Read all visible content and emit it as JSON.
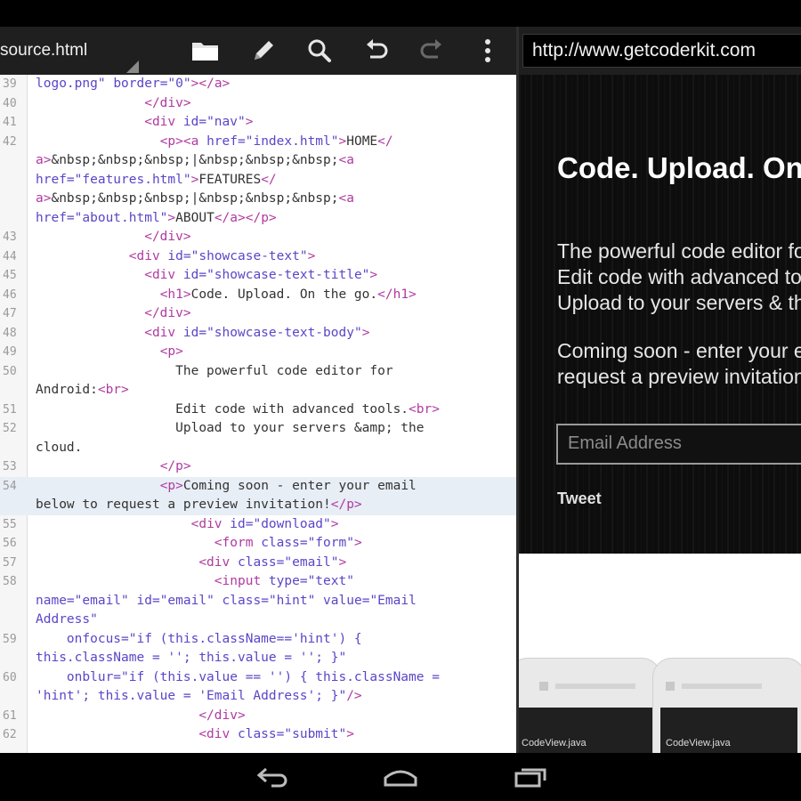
{
  "editor": {
    "file_tab": "source.html",
    "toolbar_icons": [
      "folder-icon",
      "pencil-icon",
      "search-icon",
      "undo-icon",
      "redo-icon",
      "overflow-menu-icon"
    ]
  },
  "code_lines": [
    {
      "ln": "39",
      "tokens": [
        {
          "c": "t-str",
          "t": "logo.png\" "
        },
        {
          "c": "t-attr",
          "t": "border="
        },
        {
          "c": "t-str",
          "t": "\"0\""
        },
        {
          "c": "t-tag",
          "t": "></a>"
        }
      ]
    },
    {
      "ln": "40",
      "tokens": [
        {
          "c": "t-txt",
          "t": "              "
        },
        {
          "c": "t-tag",
          "t": "</div>"
        }
      ]
    },
    {
      "ln": "41",
      "tokens": [
        {
          "c": "t-txt",
          "t": "              "
        },
        {
          "c": "t-tag",
          "t": "<div "
        },
        {
          "c": "t-attr",
          "t": "id="
        },
        {
          "c": "t-str",
          "t": "\"nav\""
        },
        {
          "c": "t-tag",
          "t": ">"
        }
      ]
    },
    {
      "ln": "42",
      "tokens": [
        {
          "c": "t-txt",
          "t": "                "
        },
        {
          "c": "t-tag",
          "t": "<p><a "
        },
        {
          "c": "t-attr",
          "t": "href="
        },
        {
          "c": "t-str",
          "t": "\"index.html\""
        },
        {
          "c": "t-tag",
          "t": ">"
        },
        {
          "c": "t-txt",
          "t": "HOME"
        },
        {
          "c": "t-tag",
          "t": "</"
        }
      ]
    },
    {
      "ln": "",
      "tokens": [
        {
          "c": "t-tag",
          "t": "a>"
        },
        {
          "c": "t-txt",
          "t": "&nbsp;&nbsp;&nbsp;|&nbsp;&nbsp;&nbsp;"
        },
        {
          "c": "t-tag",
          "t": "<a"
        }
      ]
    },
    {
      "ln": "",
      "tokens": [
        {
          "c": "t-attr",
          "t": "href="
        },
        {
          "c": "t-str",
          "t": "\"features.html\""
        },
        {
          "c": "t-tag",
          "t": ">"
        },
        {
          "c": "t-txt",
          "t": "FEATURES"
        },
        {
          "c": "t-tag",
          "t": "</"
        }
      ]
    },
    {
      "ln": "",
      "tokens": [
        {
          "c": "t-tag",
          "t": "a>"
        },
        {
          "c": "t-txt",
          "t": "&nbsp;&nbsp;&nbsp;|&nbsp;&nbsp;&nbsp;"
        },
        {
          "c": "t-tag",
          "t": "<a"
        }
      ]
    },
    {
      "ln": "",
      "tokens": [
        {
          "c": "t-attr",
          "t": "href="
        },
        {
          "c": "t-str",
          "t": "\"about.html\""
        },
        {
          "c": "t-tag",
          "t": ">"
        },
        {
          "c": "t-txt",
          "t": "ABOUT"
        },
        {
          "c": "t-tag",
          "t": "</a></p>"
        }
      ]
    },
    {
      "ln": "43",
      "tokens": [
        {
          "c": "t-txt",
          "t": "              "
        },
        {
          "c": "t-tag",
          "t": "</div>"
        }
      ]
    },
    {
      "ln": "44",
      "tokens": [
        {
          "c": "t-txt",
          "t": "            "
        },
        {
          "c": "t-tag",
          "t": "<div "
        },
        {
          "c": "t-attr",
          "t": "id="
        },
        {
          "c": "t-str",
          "t": "\"showcase-text\""
        },
        {
          "c": "t-tag",
          "t": ">"
        }
      ]
    },
    {
      "ln": "45",
      "tokens": [
        {
          "c": "t-txt",
          "t": "              "
        },
        {
          "c": "t-tag",
          "t": "<div "
        },
        {
          "c": "t-attr",
          "t": "id="
        },
        {
          "c": "t-str",
          "t": "\"showcase-text-title\""
        },
        {
          "c": "t-tag",
          "t": ">"
        }
      ]
    },
    {
      "ln": "46",
      "tokens": [
        {
          "c": "t-txt",
          "t": "                "
        },
        {
          "c": "t-tag",
          "t": "<h1>"
        },
        {
          "c": "t-txt",
          "t": "Code. Upload. On the go."
        },
        {
          "c": "t-tag",
          "t": "</h1>"
        }
      ]
    },
    {
      "ln": "47",
      "tokens": [
        {
          "c": "t-txt",
          "t": "              "
        },
        {
          "c": "t-tag",
          "t": "</div>"
        }
      ]
    },
    {
      "ln": "48",
      "tokens": [
        {
          "c": "t-txt",
          "t": "              "
        },
        {
          "c": "t-tag",
          "t": "<div "
        },
        {
          "c": "t-attr",
          "t": "id="
        },
        {
          "c": "t-str",
          "t": "\"showcase-text-body\""
        },
        {
          "c": "t-tag",
          "t": ">"
        }
      ]
    },
    {
      "ln": "49",
      "tokens": [
        {
          "c": "t-txt",
          "t": "                "
        },
        {
          "c": "t-tag",
          "t": "<p>"
        }
      ]
    },
    {
      "ln": "50",
      "tokens": [
        {
          "c": "t-txt",
          "t": "                  The powerful code editor for"
        }
      ]
    },
    {
      "ln": "",
      "tokens": [
        {
          "c": "t-txt",
          "t": "Android:"
        },
        {
          "c": "t-tag",
          "t": "<br>"
        }
      ]
    },
    {
      "ln": "51",
      "tokens": [
        {
          "c": "t-txt",
          "t": "                  Edit code with advanced tools."
        },
        {
          "c": "t-tag",
          "t": "<br>"
        }
      ]
    },
    {
      "ln": "52",
      "tokens": [
        {
          "c": "t-txt",
          "t": "                  Upload to your servers &amp; the"
        }
      ]
    },
    {
      "ln": "",
      "tokens": [
        {
          "c": "t-txt",
          "t": "cloud."
        }
      ]
    },
    {
      "ln": "53",
      "tokens": [
        {
          "c": "t-txt",
          "t": "                "
        },
        {
          "c": "t-tag",
          "t": "</p>"
        }
      ]
    },
    {
      "ln": "54",
      "hl": true,
      "tokens": [
        {
          "c": "t-txt",
          "t": "                "
        },
        {
          "c": "t-tag",
          "t": "<p>"
        },
        {
          "c": "t-txt",
          "t": "Coming soon - enter your email"
        }
      ]
    },
    {
      "ln": "",
      "hl": true,
      "tokens": [
        {
          "c": "t-txt",
          "t": "below to request a preview invitation!"
        },
        {
          "c": "t-tag",
          "t": "</p>"
        }
      ]
    },
    {
      "ln": "55",
      "tokens": [
        {
          "c": "t-txt",
          "t": "                    "
        },
        {
          "c": "t-tag",
          "t": "<div "
        },
        {
          "c": "t-attr",
          "t": "id="
        },
        {
          "c": "t-str",
          "t": "\"download\""
        },
        {
          "c": "t-tag",
          "t": ">"
        }
      ]
    },
    {
      "ln": "56",
      "tokens": [
        {
          "c": "t-txt",
          "t": "                       "
        },
        {
          "c": "t-tag",
          "t": "<form "
        },
        {
          "c": "t-attr",
          "t": "class="
        },
        {
          "c": "t-str",
          "t": "\"form\""
        },
        {
          "c": "t-tag",
          "t": ">"
        }
      ]
    },
    {
      "ln": "57",
      "tokens": [
        {
          "c": "t-txt",
          "t": "                     "
        },
        {
          "c": "t-tag",
          "t": "<div "
        },
        {
          "c": "t-attr",
          "t": "class="
        },
        {
          "c": "t-str",
          "t": "\"email\""
        },
        {
          "c": "t-tag",
          "t": ">"
        }
      ]
    },
    {
      "ln": "58",
      "tokens": [
        {
          "c": "t-txt",
          "t": "                       "
        },
        {
          "c": "t-tag",
          "t": "<input "
        },
        {
          "c": "t-attr",
          "t": "type="
        },
        {
          "c": "t-str",
          "t": "\"text\""
        }
      ]
    },
    {
      "ln": "",
      "tokens": [
        {
          "c": "t-attr",
          "t": "name="
        },
        {
          "c": "t-str",
          "t": "\"email\" "
        },
        {
          "c": "t-attr",
          "t": "id="
        },
        {
          "c": "t-str",
          "t": "\"email\" "
        },
        {
          "c": "t-attr",
          "t": "class="
        },
        {
          "c": "t-str",
          "t": "\"hint\" "
        },
        {
          "c": "t-attr",
          "t": "value="
        },
        {
          "c": "t-str",
          "t": "\"Email"
        }
      ]
    },
    {
      "ln": "",
      "tokens": [
        {
          "c": "t-str",
          "t": "Address\""
        }
      ]
    },
    {
      "ln": "59",
      "tokens": [
        {
          "c": "t-txt",
          "t": "    "
        },
        {
          "c": "t-attr",
          "t": "onfocus="
        },
        {
          "c": "t-str",
          "t": "\"if (this.className=='hint') {"
        }
      ]
    },
    {
      "ln": "",
      "tokens": [
        {
          "c": "t-str",
          "t": "this.className = ''; this.value = ''; }\""
        }
      ]
    },
    {
      "ln": "60",
      "tokens": [
        {
          "c": "t-txt",
          "t": "    "
        },
        {
          "c": "t-attr",
          "t": "onblur="
        },
        {
          "c": "t-str",
          "t": "\"if (this.value == '') { this.className ="
        }
      ]
    },
    {
      "ln": "",
      "tokens": [
        {
          "c": "t-str",
          "t": "'hint'; this.value = 'Email Address'; }\""
        },
        {
          "c": "t-tag",
          "t": "/>"
        }
      ]
    },
    {
      "ln": "61",
      "tokens": [
        {
          "c": "t-txt",
          "t": "                     "
        },
        {
          "c": "t-tag",
          "t": "</div>"
        }
      ]
    },
    {
      "ln": "62",
      "tokens": [
        {
          "c": "t-txt",
          "t": "                     "
        },
        {
          "c": "t-tag",
          "t": "<div "
        },
        {
          "c": "t-attr",
          "t": "class="
        },
        {
          "c": "t-str",
          "t": "\"submit\""
        },
        {
          "c": "t-tag",
          "t": ">"
        }
      ]
    }
  ],
  "browser": {
    "url": "http://www.getcoderkit.com"
  },
  "preview": {
    "title": "Code. Upload. On the go.",
    "desc_lines": [
      "The powerful code editor for Android:",
      "Edit code with advanced tools.",
      "Upload to your servers & the cloud."
    ],
    "coming_lines": [
      "Coming soon - enter your email below to",
      "request a preview invitation!"
    ],
    "email_placeholder": "Email Address",
    "tweet_label": "Tweet",
    "device_labels": [
      "CodeView.java",
      "CodeView.java"
    ]
  },
  "colors": {
    "toolbar_bg": "#1f1f1f",
    "code_tag": "#b03aa0",
    "code_attr": "#5a46c8",
    "highlight_line": "#e8eef6"
  },
  "nav_icons": [
    "back-icon",
    "home-icon",
    "recent-apps-icon"
  ]
}
